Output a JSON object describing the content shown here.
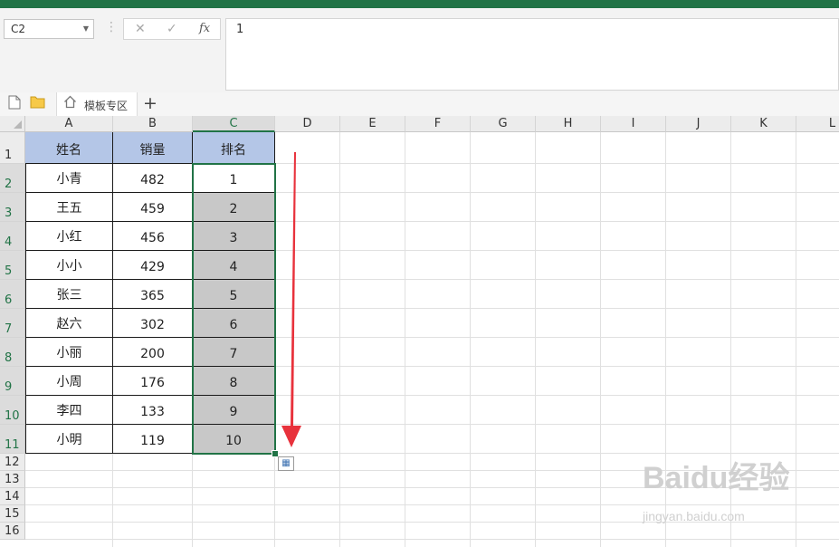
{
  "formula_bar": {
    "name_box": "C2",
    "formula_value": "1",
    "cancel_icon": "✕",
    "confirm_icon": "✓",
    "fx_label": "fx"
  },
  "tabs": {
    "template_tab": "模板专区",
    "add_tab": "+"
  },
  "columns": [
    "A",
    "B",
    "C",
    "D",
    "E",
    "F",
    "G",
    "H",
    "I",
    "J",
    "K",
    "L"
  ],
  "rows": [
    "1",
    "2",
    "3",
    "4",
    "5",
    "6",
    "7",
    "8",
    "9",
    "10",
    "11",
    "12",
    "13",
    "14",
    "15",
    "16"
  ],
  "active_column": "C",
  "table": {
    "headers": [
      "姓名",
      "销量",
      "排名"
    ],
    "rows": [
      [
        "小青",
        "482",
        "1"
      ],
      [
        "王五",
        "459",
        "2"
      ],
      [
        "小红",
        "456",
        "3"
      ],
      [
        "小小",
        "429",
        "4"
      ],
      [
        "张三",
        "365",
        "5"
      ],
      [
        "赵六",
        "302",
        "6"
      ],
      [
        "小丽",
        "200",
        "7"
      ],
      [
        "小周",
        "176",
        "8"
      ],
      [
        "李四",
        "133",
        "9"
      ],
      [
        "小明",
        "119",
        "10"
      ]
    ]
  },
  "colors": {
    "accent": "#217346",
    "header_fill": "#b4c6e7",
    "selection_fill": "#c8c8c8",
    "annotation_arrow": "#e8323c"
  },
  "watermark": {
    "brand": "Baidu经验",
    "url": "jingyan.baidu.com"
  }
}
